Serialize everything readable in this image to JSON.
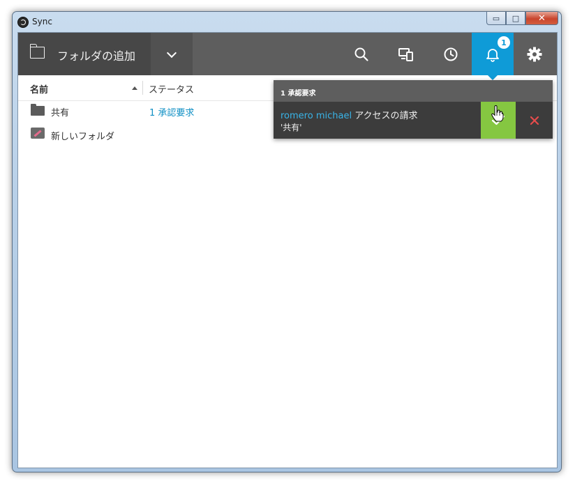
{
  "window": {
    "title": "Sync",
    "minimize_symbol": "▭",
    "maximize_symbol": "□",
    "close_symbol": "✕"
  },
  "toolbar": {
    "add_folder_label": "フォルダの追加",
    "notification_count": "1",
    "icons": [
      "folder-icon",
      "chevron-down-icon",
      "search-icon",
      "devices-icon",
      "history-clock-icon",
      "bell-icon",
      "gear-icon"
    ],
    "active_color": "#0f9bd7"
  },
  "columns": {
    "name": "名前",
    "status": "ステータス"
  },
  "rows": [
    {
      "name": "共有",
      "status": "1 承認要求",
      "icon": "folder-icon"
    },
    {
      "name": "新しいフォルダ",
      "status": "",
      "icon": "folder-edit-icon"
    }
  ],
  "popup": {
    "header": "1 承認要求",
    "user": "romero michael",
    "action": "アクセスの請求",
    "folder": "'共有'",
    "accept_color": "#85c741",
    "reject_color": "#e64c4c"
  }
}
